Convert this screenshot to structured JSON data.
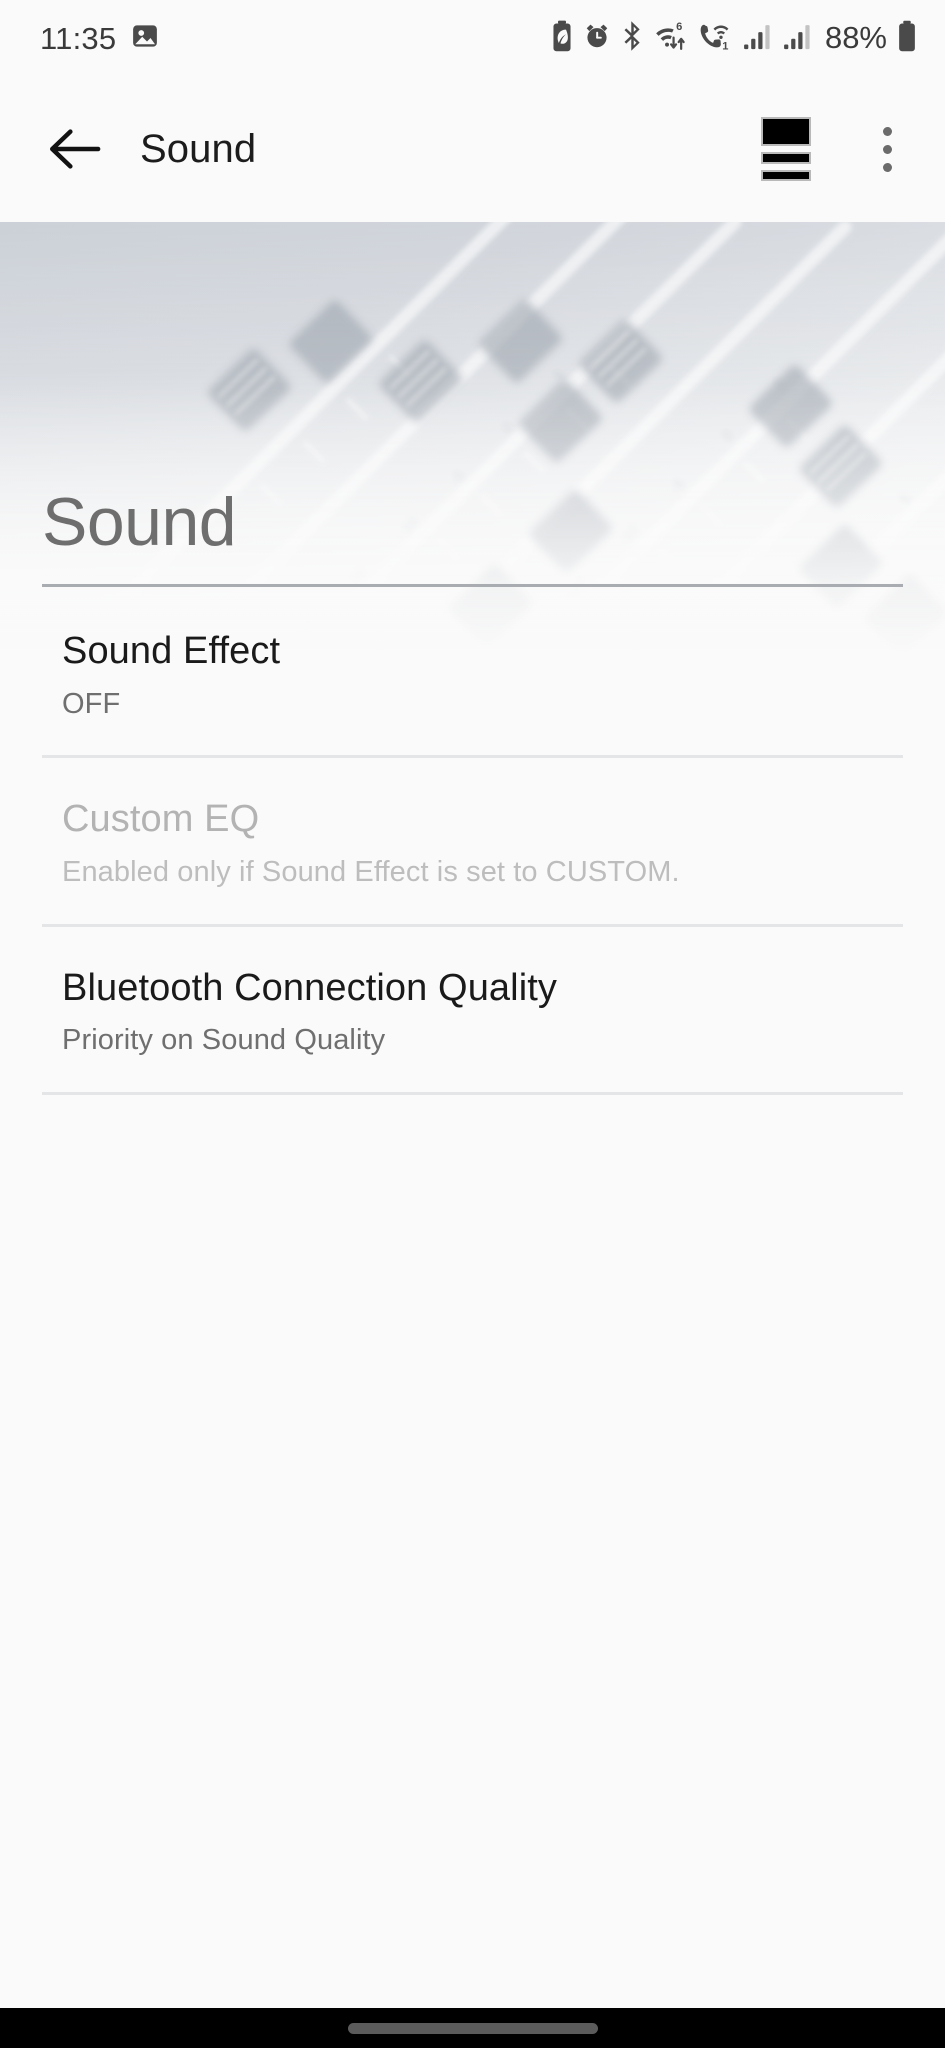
{
  "status_bar": {
    "time": "11:35",
    "battery_percent": "88%",
    "left_icons": [
      {
        "name": "photo-notification-icon",
        "label": "Photo"
      }
    ],
    "right_icons": [
      {
        "name": "battery-saver-icon",
        "label": "Battery saver"
      },
      {
        "name": "alarm-icon",
        "label": "Alarm set"
      },
      {
        "name": "bluetooth-icon",
        "label": "Bluetooth on"
      },
      {
        "name": "wifi-6-data-transfer-icon",
        "label": "Wi-Fi 6 with data transfer"
      },
      {
        "name": "wifi-calling-icon",
        "label": "Wi-Fi calling 1"
      },
      {
        "name": "cellular-signal-1-icon",
        "label": "SIM 1 signal"
      },
      {
        "name": "cellular-signal-2-icon",
        "label": "SIM 2 signal"
      },
      {
        "name": "battery-icon",
        "label": "Battery"
      }
    ]
  },
  "app_bar": {
    "back_label": "Back",
    "title": "Sound",
    "level_action_label": "Level",
    "overflow_label": "More options"
  },
  "hero": {
    "alt": "Faded photo of an audio mixing console with faders"
  },
  "page": {
    "title": "Sound"
  },
  "preferences": [
    {
      "id": "sound-effect",
      "title": "Sound Effect",
      "summary": "OFF",
      "enabled": true
    },
    {
      "id": "custom-eq",
      "title": "Custom EQ",
      "summary": "Enabled only if Sound Effect is set to CUSTOM.",
      "enabled": false
    },
    {
      "id": "bluetooth-connection-quality",
      "title": "Bluetooth Connection Quality",
      "summary": "Priority on Sound Quality",
      "enabled": true
    }
  ],
  "nav_bar": {
    "gesture_pill_label": "Home gesture bar"
  },
  "colors": {
    "background": "#fafafa",
    "title_text": "#6e6e6e",
    "primary_text": "#1a1a1a",
    "secondary_text": "#6f6f6f",
    "disabled_text": "#b3b3b3",
    "divider": "#e4e5e6",
    "title_divider": "#a9adb2",
    "nav_bar": "#000000",
    "hero_tint": "#ccd1d8"
  }
}
